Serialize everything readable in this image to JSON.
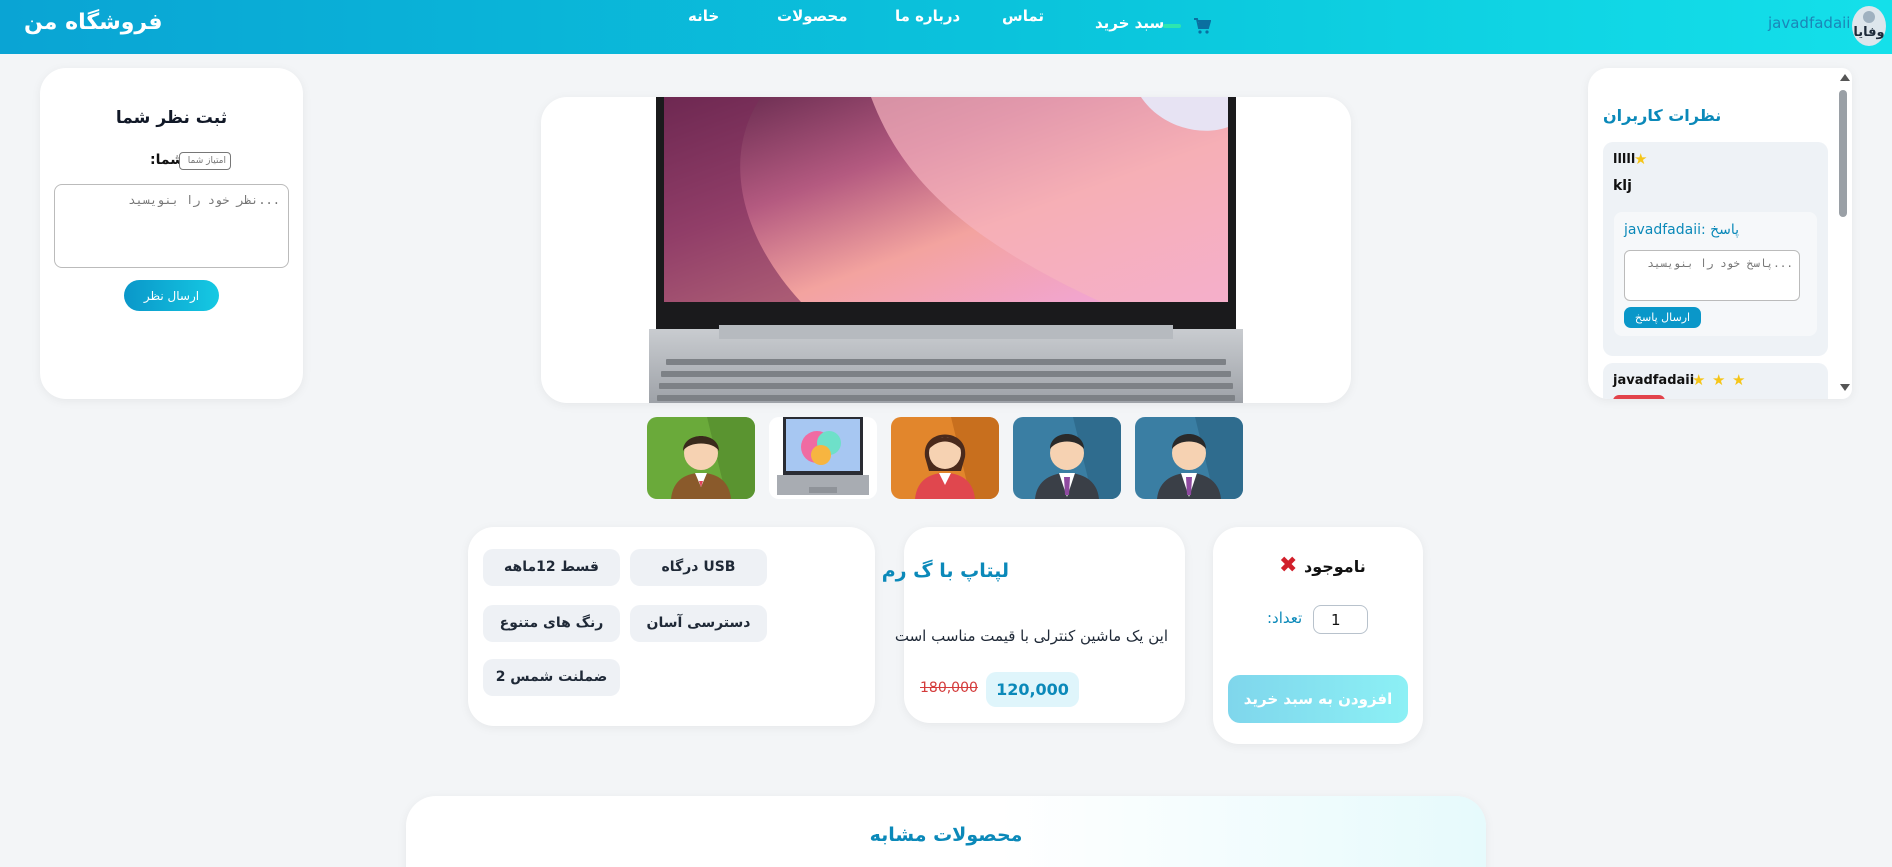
{
  "header": {
    "brand": "فروشگاه من",
    "nav": [
      "خانه",
      "محصولات",
      "درباره ما",
      "تماس"
    ],
    "cart_label": "سبد خرید",
    "username": "javadfadaii",
    "avatar_text": "وفایا",
    "colors": {
      "gradient_start": "#0aa4d4",
      "gradient_end": "#14e0ea",
      "cart_dash": "#2de6b0"
    }
  },
  "review_form": {
    "title": "ثبت نظر شما",
    "rating_label": ":امتیاز شما",
    "rating_placeholder": "امتیاز شما",
    "comment_placeholder": "...نظر خود را بنویسید",
    "submit_label": "ارسال نظر"
  },
  "gallery": {
    "thumbnails": [
      "avatar-green",
      "laptop",
      "avatar-orange",
      "avatar-blue",
      "avatar-blue"
    ]
  },
  "features": [
    "USB درگاه",
    "قسط 12ماهه",
    "دسترسی آسان",
    "رنگ های متنوع",
    "ضملنت شمس 2"
  ],
  "product": {
    "title": "لپتاپ با گ رم",
    "description": "این یک ماشین کنترلی با قیمت مناسب است",
    "old_price": "180,000",
    "new_price": "120,000"
  },
  "stock": {
    "status": "ناموجود",
    "quantity_label": "تعداد:",
    "quantity_value": "1",
    "add_to_cart_label": "افزودن به سبد خرید"
  },
  "comments": {
    "title": "نظرات کاربران",
    "items": [
      {
        "user": "lllll",
        "stars": 1,
        "text": "klj",
        "reply": {
          "title": "javadfadaii: پاسخ",
          "placeholder": "...پاسخ خود را بنویسید",
          "submit_label": "ارسال پاسخ"
        }
      },
      {
        "user": "javadfadaii",
        "stars": 3
      }
    ]
  },
  "similar": {
    "title": "محصولات مشابه"
  }
}
